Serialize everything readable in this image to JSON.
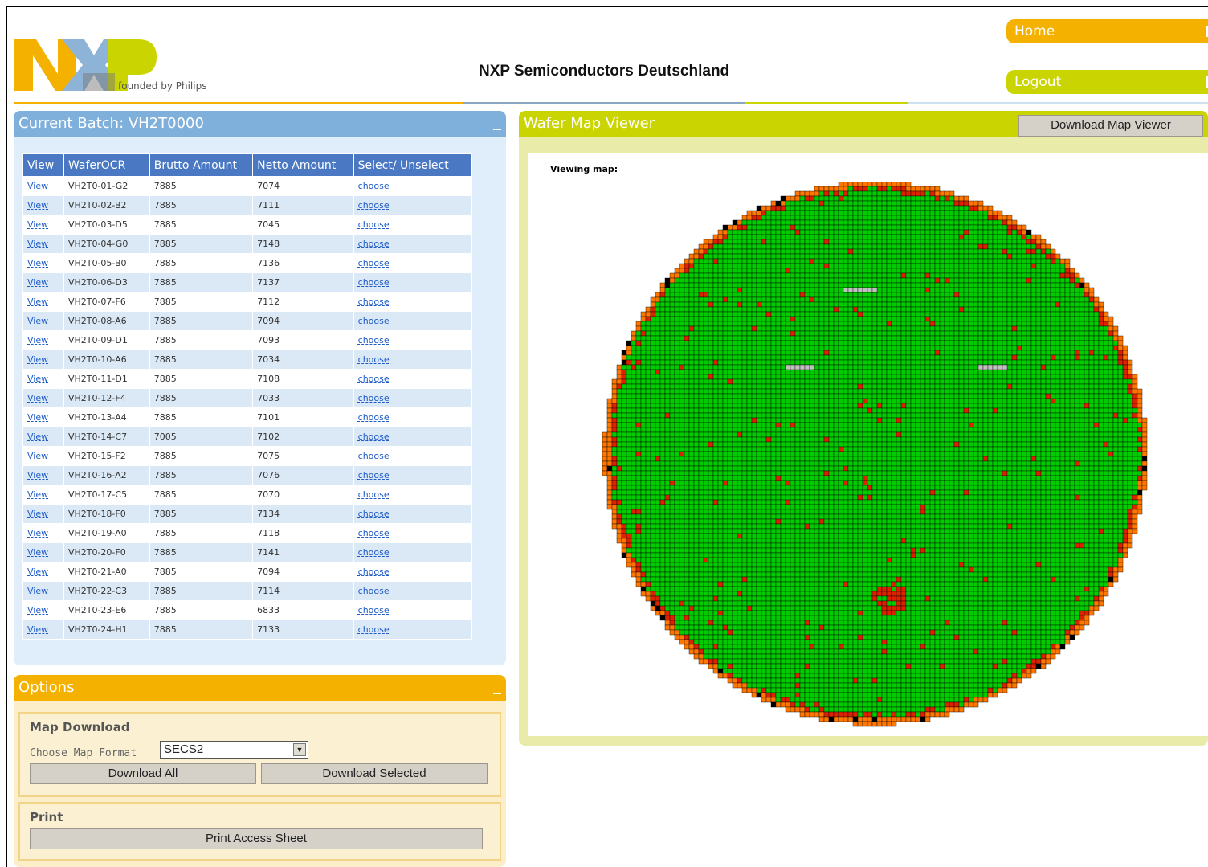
{
  "header": {
    "logo_text": "NXP",
    "tagline": "founded by Philips",
    "title": "NXP Semiconductors Deutschland",
    "nav": {
      "home": "Home",
      "logout": "Logout"
    }
  },
  "batch_panel": {
    "title": "Current Batch: VH2T0000",
    "columns": [
      "View",
      "WaferOCR",
      "Brutto Amount",
      "Netto Amount",
      "Select/ Unselect"
    ],
    "rows": [
      [
        "View",
        "VH2T0-01-G2",
        "7885",
        "7074",
        "choose"
      ],
      [
        "View",
        "VH2T0-02-B2",
        "7885",
        "7111",
        "choose"
      ],
      [
        "View",
        "VH2T0-03-D5",
        "7885",
        "7045",
        "choose"
      ],
      [
        "View",
        "VH2T0-04-G0",
        "7885",
        "7148",
        "choose"
      ],
      [
        "View",
        "VH2T0-05-B0",
        "7885",
        "7136",
        "choose"
      ],
      [
        "View",
        "VH2T0-06-D3",
        "7885",
        "7137",
        "choose"
      ],
      [
        "View",
        "VH2T0-07-F6",
        "7885",
        "7112",
        "choose"
      ],
      [
        "View",
        "VH2T0-08-A6",
        "7885",
        "7094",
        "choose"
      ],
      [
        "View",
        "VH2T0-09-D1",
        "7885",
        "7093",
        "choose"
      ],
      [
        "View",
        "VH2T0-10-A6",
        "7885",
        "7034",
        "choose"
      ],
      [
        "View",
        "VH2T0-11-D1",
        "7885",
        "7108",
        "choose"
      ],
      [
        "View",
        "VH2T0-12-F4",
        "7885",
        "7033",
        "choose"
      ],
      [
        "View",
        "VH2T0-13-A4",
        "7885",
        "7101",
        "choose"
      ],
      [
        "View",
        "VH2T0-14-C7",
        "7005",
        "7102",
        "choose"
      ],
      [
        "View",
        "VH2T0-15-F2",
        "7885",
        "7075",
        "choose"
      ],
      [
        "View",
        "VH2T0-16-A2",
        "7885",
        "7076",
        "choose"
      ],
      [
        "View",
        "VH2T0-17-C5",
        "7885",
        "7070",
        "choose"
      ],
      [
        "View",
        "VH2T0-18-F0",
        "7885",
        "7134",
        "choose"
      ],
      [
        "View",
        "VH2T0-19-A0",
        "7885",
        "7118",
        "choose"
      ],
      [
        "View",
        "VH2T0-20-F0",
        "7885",
        "7141",
        "choose"
      ],
      [
        "View",
        "VH2T0-21-A0",
        "7885",
        "7094",
        "choose"
      ],
      [
        "View",
        "VH2T0-22-C3",
        "7885",
        "7114",
        "choose"
      ],
      [
        "View",
        "VH2T0-23-E6",
        "7885",
        "6833",
        "choose"
      ],
      [
        "View",
        "VH2T0-24-H1",
        "7885",
        "7133",
        "choose"
      ]
    ]
  },
  "options_panel": {
    "title": "Options",
    "map_download": {
      "title": "Map Download",
      "format_label": "Choose Map Format",
      "format_selected": "SECS2",
      "download_all": "Download All",
      "download_selected": "Download Selected"
    },
    "print": {
      "title": "Print",
      "print_access_sheet": "Print Access Sheet"
    }
  },
  "wafer_panel": {
    "title": "Wafer Map Viewer",
    "download_viewer": "Download Map Viewer",
    "viewing_label": "Viewing map:",
    "colors": {
      "good": "#00cc00",
      "fail": "#dd2200",
      "edge": "#ff7700",
      "gray": "#c0c0c0",
      "blue": "#0000cc",
      "black": "#000000"
    }
  }
}
